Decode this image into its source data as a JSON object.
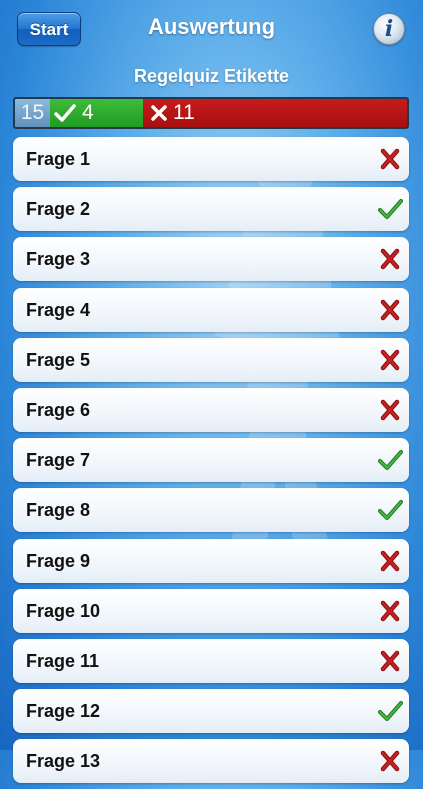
{
  "header": {
    "start_label": "Start",
    "title": "Auswertung",
    "info_glyph": "i"
  },
  "subtitle": "Regelquiz Etikette",
  "score": {
    "total": "15",
    "correct": "4",
    "wrong": "11"
  },
  "questions": [
    {
      "label": "Frage 1",
      "result": "wrong"
    },
    {
      "label": "Frage 2",
      "result": "correct"
    },
    {
      "label": "Frage 3",
      "result": "wrong"
    },
    {
      "label": "Frage 4",
      "result": "wrong"
    },
    {
      "label": "Frage 5",
      "result": "wrong"
    },
    {
      "label": "Frage 6",
      "result": "wrong"
    },
    {
      "label": "Frage 7",
      "result": "correct"
    },
    {
      "label": "Frage 8",
      "result": "correct"
    },
    {
      "label": "Frage 9",
      "result": "wrong"
    },
    {
      "label": "Frage 10",
      "result": "wrong"
    },
    {
      "label": "Frage 11",
      "result": "wrong"
    },
    {
      "label": "Frage 12",
      "result": "correct"
    },
    {
      "label": "Frage 13",
      "result": "wrong"
    }
  ],
  "icons": {
    "correct": "check-mark-icon",
    "wrong": "cross-mark-icon",
    "info": "info-icon"
  },
  "colors": {
    "correct": "#2e9a2e",
    "wrong": "#b51818",
    "accent": "#2275cf"
  }
}
